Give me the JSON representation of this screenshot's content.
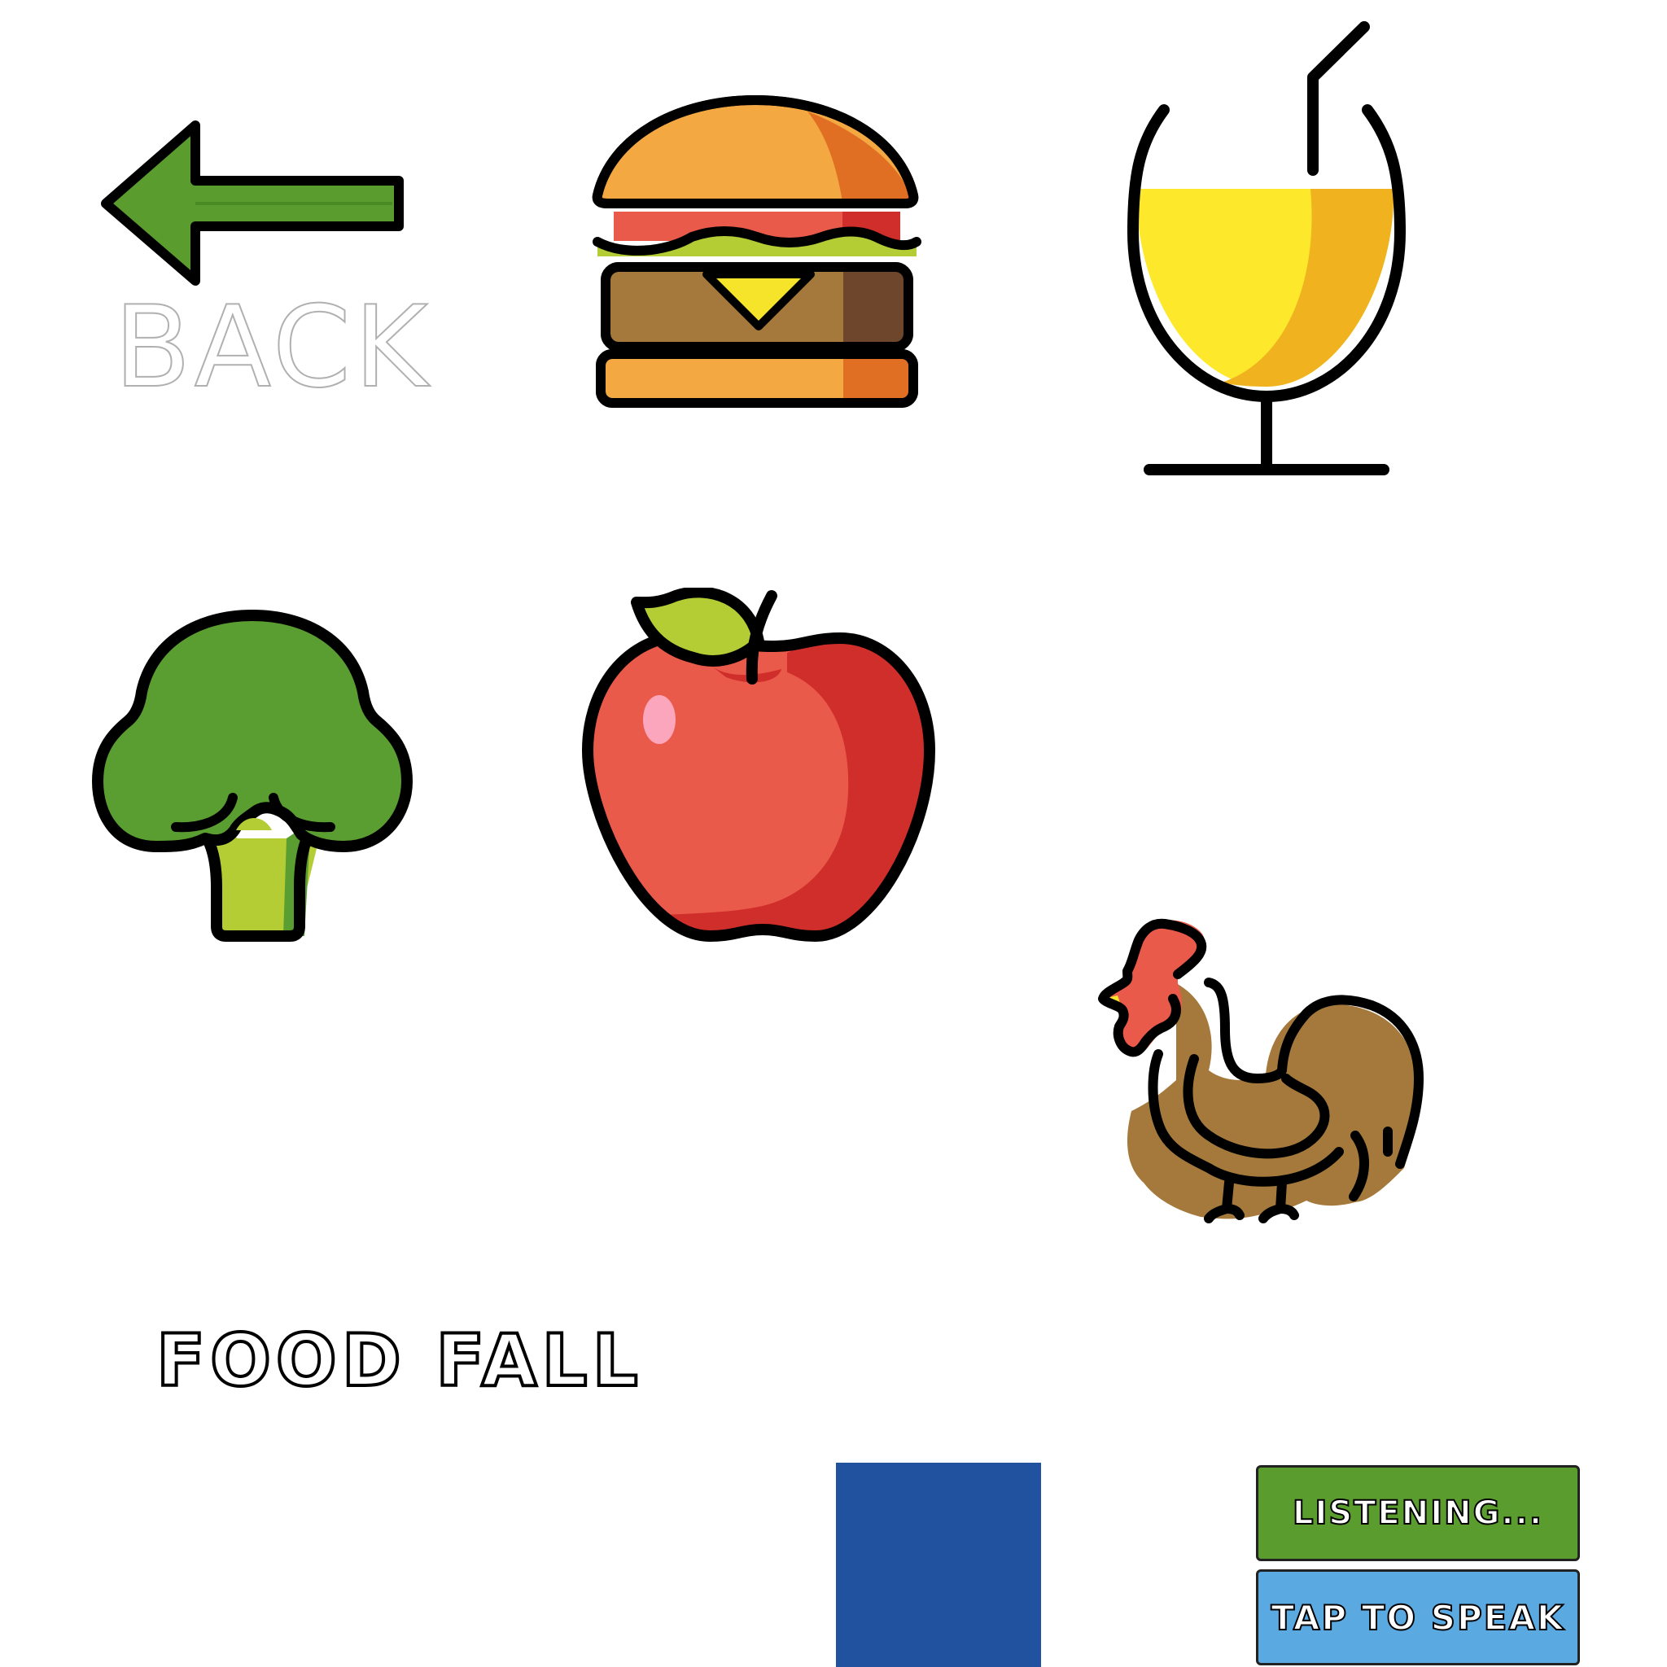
{
  "back": {
    "label": "BACK",
    "icon": "left-arrow-icon"
  },
  "foods": [
    {
      "name": "burger",
      "icon": "burger-icon"
    },
    {
      "name": "juice",
      "icon": "juice-glass-icon"
    },
    {
      "name": "broccoli",
      "icon": "broccoli-icon"
    },
    {
      "name": "apple",
      "icon": "apple-icon"
    },
    {
      "name": "chicken",
      "icon": "chicken-icon"
    }
  ],
  "game": {
    "title": "FOOD FALL"
  },
  "controls": {
    "listening_label": "LISTENING...",
    "speak_label": "TAP TO SPEAK"
  },
  "colors": {
    "catcher": "#2052a0",
    "listening": "#5b9c2e",
    "speak": "#5aa9e0",
    "arrow": "#5b9c2e"
  }
}
